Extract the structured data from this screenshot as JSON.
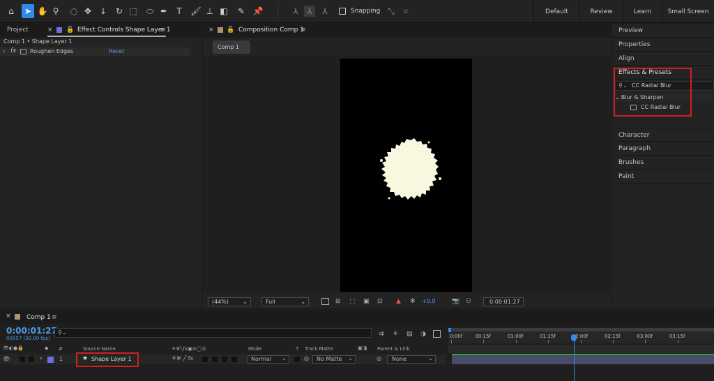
{
  "toolbar": {
    "tools": [
      {
        "name": "home-icon",
        "glyph": "⌂"
      },
      {
        "name": "selection-tool-icon",
        "glyph": "➤"
      },
      {
        "name": "hand-tool-icon",
        "glyph": "✋"
      },
      {
        "name": "zoom-tool-icon",
        "glyph": "⚲"
      },
      {
        "name": "orbit-camera-icon",
        "glyph": "◌"
      },
      {
        "name": "pan-camera-icon",
        "glyph": "✥"
      },
      {
        "name": "dolly-camera-icon",
        "glyph": "↓"
      },
      {
        "name": "rotation-tool-icon",
        "glyph": "↻"
      },
      {
        "name": "pan-behind-tool-icon",
        "glyph": "⬚"
      },
      {
        "name": "ellipse-tool-icon",
        "glyph": "⬭"
      },
      {
        "name": "pen-tool-icon",
        "glyph": "✒"
      },
      {
        "name": "type-tool-icon",
        "glyph": "T"
      },
      {
        "name": "brush-tool-icon",
        "glyph": "🖌"
      },
      {
        "name": "clone-stamp-tool-icon",
        "glyph": "⊥"
      },
      {
        "name": "eraser-tool-icon",
        "glyph": "◧"
      },
      {
        "name": "roto-brush-tool-icon",
        "glyph": "✎"
      },
      {
        "name": "puppet-pin-tool-icon",
        "glyph": "📌"
      }
    ],
    "axis_tools": [
      "⅄",
      "⅄",
      "⅄"
    ],
    "snapping_label": "Snapping",
    "workspaces": [
      "Default",
      "Review",
      "Learn",
      "Small Screen"
    ]
  },
  "project_panel": {
    "tab_project": "Project",
    "tab_effect_controls": "Effect Controls Shape Layer 1",
    "breadcrumb": "Comp 1 • Shape Layer 1",
    "effect_name": "Roughen Edges",
    "reset_label": "Reset",
    "fx_label": "fx"
  },
  "composition": {
    "tab_label": "Composition Comp 1",
    "comp_button": "Comp 1",
    "zoom": "(44%)",
    "resolution": "Full",
    "exposure": "+0.0",
    "timecode": "0:00:01:27"
  },
  "right_panel": {
    "items_top": [
      "Preview",
      "Properties",
      "Align"
    ],
    "effects_title": "Effects & Presets",
    "search_value": "CC Radial Blur",
    "category": "Blur & Sharpen",
    "result": "CC Radial Blur",
    "items_bottom": [
      "Character",
      "Paragraph",
      "Brushes",
      "Paint"
    ]
  },
  "timeline": {
    "tab_label": "Comp 1",
    "timecode": "0:00:01:27",
    "frame_info": "00057 (30.00 fps)",
    "headers": {
      "hash": "#",
      "source_name": "Source Name",
      "mode": "Mode",
      "t": "T",
      "track_matte": "Track Matte",
      "parent_link": "Parent & Link"
    },
    "ruler_labels": [
      "0:00f",
      "00:15f",
      "01:00f",
      "01:15f",
      "02:00f",
      "02:15f",
      "03:00f",
      "03:15f"
    ],
    "playhead_position_sec": 1.9,
    "layer": {
      "number": "1",
      "name": "Shape Layer 1",
      "mode": "Normal",
      "track_matte": "No Matte",
      "parent": "None"
    }
  },
  "colors": {
    "accent": "#2d8ceb",
    "highlight_box": "#d32020",
    "label_purple": "#6f6fd8",
    "blob": "#f8f8e0"
  }
}
